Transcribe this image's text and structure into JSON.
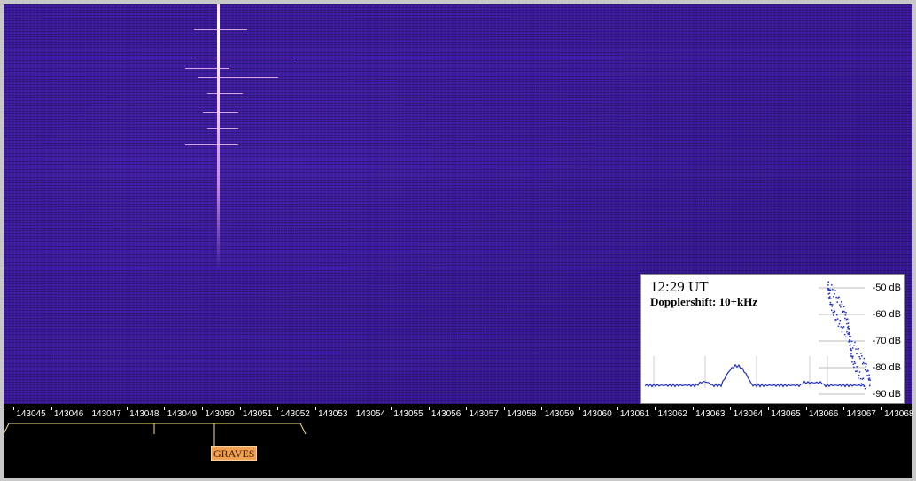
{
  "frequency_scale": {
    "labels": [
      "143045",
      "143046",
      "143047",
      "143048",
      "143049",
      "143050",
      "143051",
      "143052",
      "143053",
      "143054",
      "143055",
      "143056",
      "143057",
      "143058",
      "143059",
      "143060",
      "143061",
      "143062",
      "143063",
      "143064",
      "143065",
      "143066",
      "143067",
      "143068"
    ]
  },
  "marker": {
    "label": "GRAVES"
  },
  "inset": {
    "time": "12:29 UT",
    "dopplershift": "Dopplershift: 10+kHz",
    "db_levels": [
      "-50 dB",
      "-60 dB",
      "-70 dB",
      "-80 dB",
      "-90 dB"
    ]
  },
  "colors": {
    "waterfall_bg": "#3a1a96",
    "carrier": "#ffffff",
    "marker_bg": "#f0a050",
    "scale_text": "#ffffff",
    "spectrum_trace": "#2030c0"
  }
}
